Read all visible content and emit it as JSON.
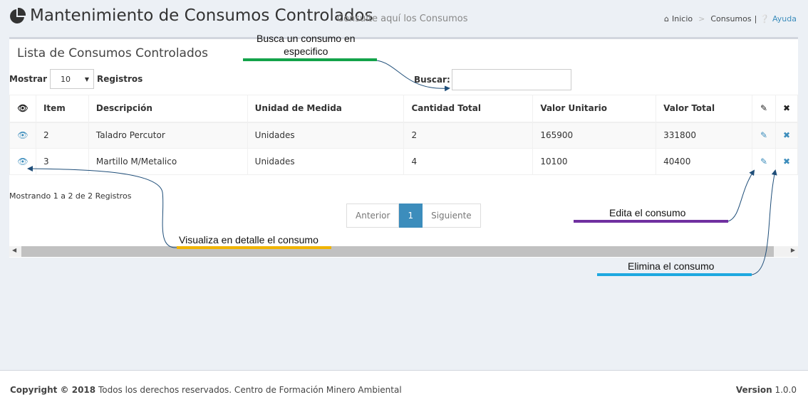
{
  "header": {
    "title": "Mantenimiento de Consumos Controlados",
    "subtitle": "Consulte aquí los Consumos",
    "breadcrumb": {
      "home": "Inicio",
      "current": "Consumos",
      "help": "Ayuda"
    }
  },
  "box": {
    "title": "Lista de Consumos Controlados",
    "length_prefix": "Mostrar",
    "length_value": "10",
    "length_suffix": "Registros",
    "search_label": "Buscar:",
    "search_value": ""
  },
  "table": {
    "headers": [
      "Item",
      "Descripción",
      "Unidad de Medida",
      "Cantidad Total",
      "Valor Unitario",
      "Valor Total"
    ],
    "rows": [
      [
        "2",
        "Taladro Percutor",
        "Unidades",
        "2",
        "165900",
        "331800"
      ],
      [
        "3",
        "Martillo M/Metalico",
        "Unidades",
        "4",
        "10100",
        "40400"
      ]
    ],
    "icons": {
      "view": "eye-icon",
      "edit": "pencil-icon",
      "delete": "times-icon"
    }
  },
  "info": "Mostrando 1 a 2 de 2 Registros",
  "pagination": {
    "prev": "Anterior",
    "page": "1",
    "next": "Siguiente"
  },
  "annotations": {
    "search": "Busca un consumo en especifico",
    "search_line1": "Busca un consumo en",
    "search_line2": "especifico",
    "view": "Visualiza en detalle el consumo",
    "edit": "Edita el consumo",
    "delete": "Elimina el consumo"
  },
  "colors": {
    "accent": "#3c8dbc",
    "annot_search": "#13a34a",
    "annot_view": "#f0b400",
    "annot_edit": "#7030a0",
    "annot_delete": "#1ea8e0",
    "arrow": "#1f4e79"
  },
  "footer": {
    "copyright_bold": "Copyright © 2018",
    "copyright_rest": "Todos los derechos reservados. Centro de Formación Minero Ambiental",
    "version_label": "Version",
    "version_value": "1.0.0"
  }
}
